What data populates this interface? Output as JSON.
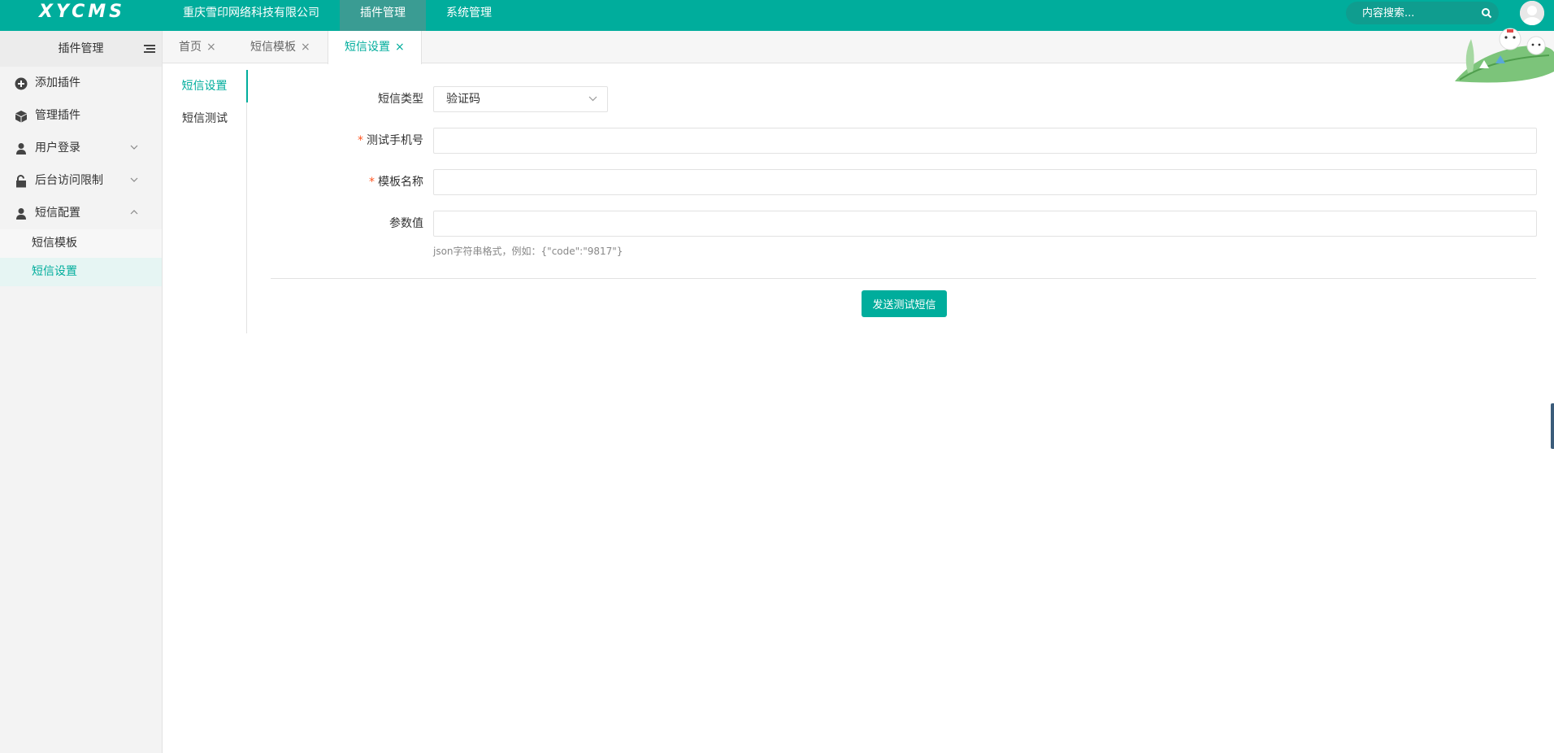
{
  "app": {
    "logo": "XYCMS"
  },
  "topnav": {
    "items": [
      {
        "label": "重庆雪印网络科技有限公司"
      },
      {
        "label": "插件管理"
      },
      {
        "label": "系统管理"
      }
    ]
  },
  "search": {
    "placeholder": "内容搜索..."
  },
  "sidebar": {
    "title": "插件管理",
    "items": [
      {
        "label": "添加插件"
      },
      {
        "label": "管理插件"
      },
      {
        "label": "用户登录"
      },
      {
        "label": "后台访问限制"
      },
      {
        "label": "短信配置"
      }
    ],
    "subitems": [
      {
        "label": "短信模板"
      },
      {
        "label": "短信设置"
      }
    ]
  },
  "tabs": [
    {
      "label": "首页"
    },
    {
      "label": "短信模板"
    },
    {
      "label": "短信设置"
    }
  ],
  "tab_close": "×",
  "subnav": [
    {
      "label": "短信设置"
    },
    {
      "label": "短信测试"
    }
  ],
  "form": {
    "required_mark": "*",
    "sms_type": {
      "label": "短信类型",
      "value": "验证码"
    },
    "phone": {
      "label": "测试手机号",
      "value": "",
      "placeholder": ""
    },
    "template": {
      "label": "模板名称",
      "value": "",
      "placeholder": ""
    },
    "params": {
      "label": "参数值",
      "value": "",
      "placeholder": ""
    },
    "hint": "json字符串格式，例如：{\"code\":\"9817\"}",
    "submit_label": "发送测试短信"
  },
  "colors": {
    "primary": "#00ad9c",
    "required": "#ff5722"
  }
}
